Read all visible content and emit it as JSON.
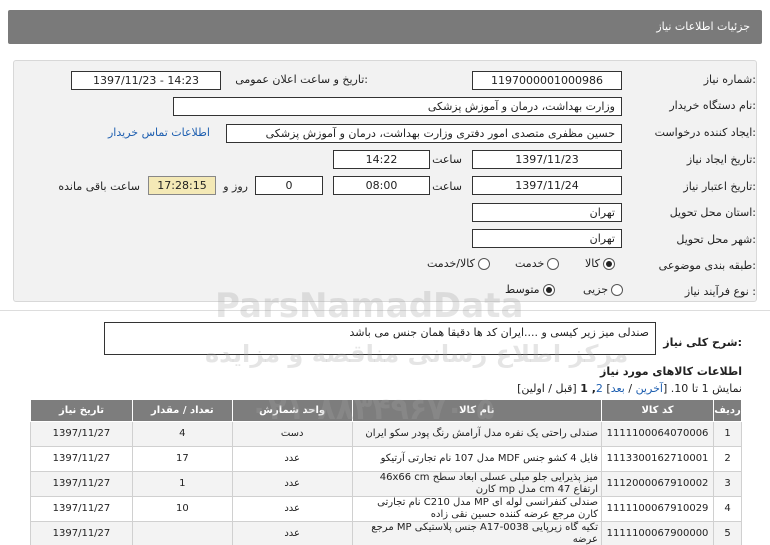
{
  "header": {
    "title": "جزئیات اطلاعات نیاز"
  },
  "form": {
    "need_number_label": "شماره نیاز:",
    "need_number": "1197000001000986",
    "announce_label": "تاریخ و ساعت اعلان عمومی:",
    "announce_value": "1397/11/23 - 14:23",
    "buyer_label": "نام دستگاه خریدار:",
    "buyer_value": "وزارت بهداشت، درمان و آموزش پزشکی",
    "creator_label": "ایجاد کننده درخواست:",
    "creator_value": "حسین  مظفری متصدی امور دفتری وزارت بهداشت، درمان و آموزش پزشکی",
    "contact_link": "اطلاعات تماس خریدار",
    "created_date_label": "تاریخ ایجاد نیاز:",
    "created_date": "1397/11/23",
    "time_label": "ساعت",
    "created_time": "14:22",
    "validity_label": "تاریخ اعتبار نیاز:",
    "validity_date": "1397/11/24",
    "validity_time": "08:00",
    "days_value": "0",
    "days_label": "روز و",
    "remaining_value": "17:28:15",
    "remaining_label": "ساعت باقی مانده",
    "province_label": "استان محل تحویل:",
    "province_value": "تهران",
    "city_label": "شهر محل تحویل:",
    "city_value": "تهران",
    "category_label": "طبقه بندی موضوعی:",
    "category_options": [
      "کالا",
      "خدمت",
      "کالا/خدمت"
    ],
    "category_selected": "کالا",
    "process_label": "نوع فرآیند نیاز :",
    "process_options": [
      "جزیی",
      "متوسط"
    ],
    "process_selected": "متوسط"
  },
  "description": {
    "label": "شرح کلی نیاز:",
    "value": "صندلی میز زیر کیسی و ....ایران کد ها دقیقا همان جنس می باشد"
  },
  "goods": {
    "title": "اطلاعات کالاهای مورد نیاز",
    "pagination_text": "نمایش 1 تا 10. [",
    "pagination_last": "آخرین",
    "pagination_sep": "/",
    "pagination_next": "بعد",
    "pagination_page2": "2",
    "pagination_page1": ", 1",
    "pagination_tail": "[قبل / اولین]",
    "columns": [
      "ردیف",
      "کد کالا",
      "نام کالا",
      "واحد شمارش",
      "تعداد / مقدار",
      "تاریخ نیاز"
    ],
    "rows": [
      {
        "index": "1",
        "code": "1111100064070006",
        "name": "صندلی راحتی یک نفره مدل آرامش رنگ پودر سکو ایران",
        "unit": "دست",
        "qty": "4",
        "date": "1397/11/27"
      },
      {
        "index": "2",
        "code": "1113300162710001",
        "name": "فایل 4 کشو جنس MDF مدل 107 نام تجارتی آرتیکو",
        "unit": "عدد",
        "qty": "17",
        "date": "1397/11/27"
      },
      {
        "index": "3",
        "code": "1112000067910002",
        "name": "میز پذیرایی جلو مبلی عسلی ابعاد سطح 46x66 cm ارتفاع 47 cm مدل mp کارن",
        "unit": "عدد",
        "qty": "1",
        "date": "1397/11/27"
      },
      {
        "index": "4",
        "code": "1111100067910029",
        "name": "صندلی کنفرانسی لوله ای MP مدل C210 نام تجارتی کارن مرجع عرضه کننده حسین نقی زاده",
        "unit": "عدد",
        "qty": "10",
        "date": "1397/11/27"
      },
      {
        "index": "5",
        "code": "1111100067900000",
        "name": "تکیه گاه زیرپایی A17-0038 جنس پلاستیکی MP مرجع عرضه",
        "unit": "عدد",
        "qty": "",
        "date": "1397/11/27"
      }
    ]
  },
  "watermarks": {
    "brand": "ParsNamadData",
    "brand_fa": "مرکز اطلاع رسانی مناقصه و مزایده",
    "phone": "۰۲۱-۸۸۳۴۹۶۷۰-۵"
  }
}
